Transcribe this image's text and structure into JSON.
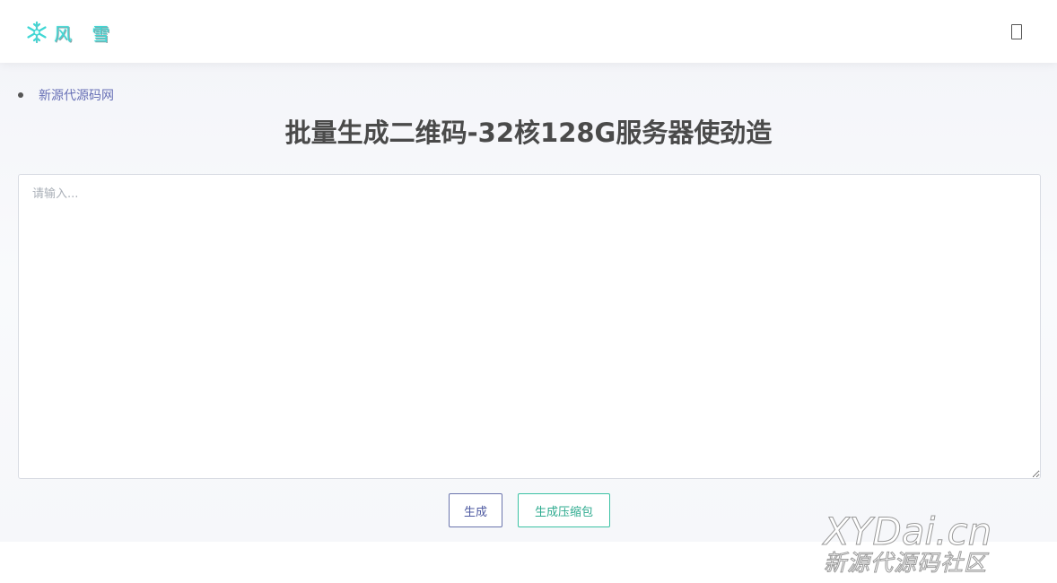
{
  "header": {
    "logo_text": "风 雪",
    "logo_icon": "snowflake-icon",
    "menu_icon": "menu-toggle-icon"
  },
  "links": [
    {
      "label": "新源代源码网"
    }
  ],
  "page_title": "批量生成二维码-32核128G服务器使劲造",
  "textarea": {
    "placeholder": "请输入...",
    "value": ""
  },
  "buttons": {
    "generate": "生成",
    "generate_zip": "生成压缩包"
  },
  "watermark": {
    "line1": "XYDai.cn",
    "line2": "新源代源码社区"
  },
  "colors": {
    "logo": "#3fd7d4",
    "link": "#6770b6",
    "generate_border": "#6b75ad",
    "zip_border": "#3cc2a4",
    "title": "#4a4a4a"
  }
}
